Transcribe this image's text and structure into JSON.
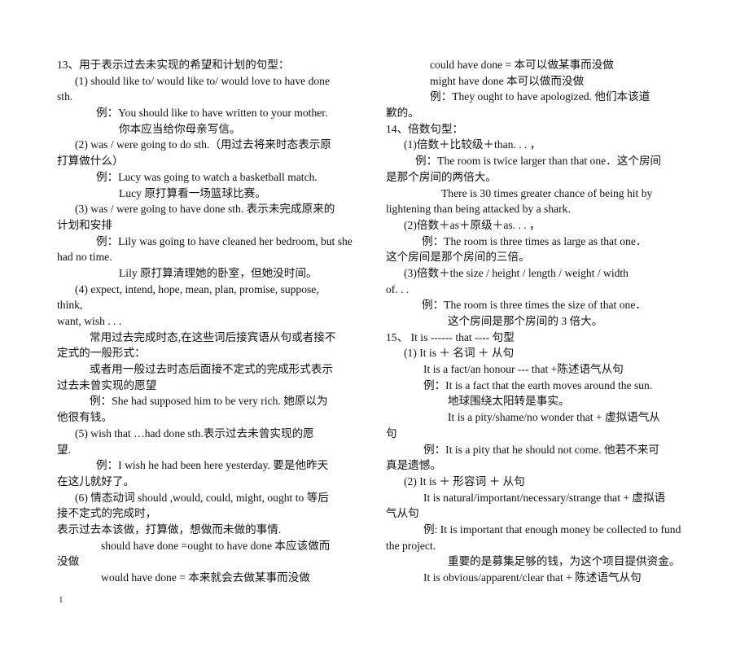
{
  "document": {
    "page_number": "1",
    "left_column": [
      {
        "text": "13、用于表示过去未实现的希望和计划的句型：",
        "indent": "",
        "role": "section-heading"
      },
      {
        "text": "(1) should like to/ would like to/ would love to have done",
        "indent": "i1",
        "role": "pattern"
      },
      {
        "text": "sth.",
        "indent": "",
        "role": "pattern-cont"
      },
      {
        "text": "例：You should like to have written to your mother.",
        "indent": "i2",
        "role": "example"
      },
      {
        "text": "你本应当给你母亲写信。",
        "indent": "i11",
        "role": "translation"
      },
      {
        "text": "(2) was / were going to do sth.（用过去将来时态表示原",
        "indent": "i1",
        "role": "pattern"
      },
      {
        "text": "打算做什么）",
        "indent": "",
        "role": "pattern-cont"
      },
      {
        "text": "例：Lucy was going to watch a basketball match.",
        "indent": "i2",
        "role": "example"
      },
      {
        "text": "Lucy  原打算看一场篮球比赛。",
        "indent": "i11",
        "role": "translation"
      },
      {
        "text": "(3) was / were going to have done sth.  表示未完成原来的",
        "indent": "i1",
        "role": "pattern"
      },
      {
        "text": "计划和安排",
        "indent": "",
        "role": "pattern-cont"
      },
      {
        "text": "例：Lily was going to have cleaned her bedroom, but she",
        "indent": "i2",
        "role": "example"
      },
      {
        "text": "had no time.",
        "indent": "",
        "role": "example-cont"
      },
      {
        "text": "Lily  原打算清理她的卧室，但她没时间。",
        "indent": "i11",
        "role": "translation"
      },
      {
        "text": "(4)  expect,  intend,  hope,  mean,  plan,  promise,  suppose,",
        "indent": "i1",
        "role": "pattern"
      },
      {
        "text": "think,",
        "indent": "",
        "role": "pattern-cont"
      },
      {
        "text": "want, wish  . . .",
        "indent": "",
        "role": "pattern-cont"
      },
      {
        "text": "常用过去完成时态,在这些词后接宾语从句或者接不",
        "indent": "i9",
        "role": "note"
      },
      {
        "text": "定式的一般形式：",
        "indent": "",
        "role": "note-cont"
      },
      {
        "text": "或者用一般过去时态后面接不定式的完成形式表示",
        "indent": "i9",
        "role": "note"
      },
      {
        "text": "过去未曾实现的愿望",
        "indent": "",
        "role": "note-cont"
      },
      {
        "text": "例：She had supposed him to be very rich.    她原以为",
        "indent": "i9",
        "role": "example"
      },
      {
        "text": "他很有钱。",
        "indent": "",
        "role": "example-cont"
      },
      {
        "text": "(5) wish that …had done sth.表示过去未曾实现的愿",
        "indent": "i1",
        "role": "pattern"
      },
      {
        "text": "望.",
        "indent": "",
        "role": "pattern-cont"
      },
      {
        "text": "例：I wish he had been here yesterday.  要是他昨天",
        "indent": "i2",
        "role": "example"
      },
      {
        "text": "在这儿就好了。",
        "indent": "",
        "role": "example-cont"
      },
      {
        "text": "(6)  情态动词 should ,would, could, might, ought to 等后",
        "indent": "i1",
        "role": "pattern"
      },
      {
        "text": "接不定式的完成时，",
        "indent": "",
        "role": "pattern-cont"
      },
      {
        "text": "表示过去本该做，打算做，想做而未做的事情.",
        "indent": "",
        "role": "note"
      },
      {
        "text": "should have done =ought to have done    本应该做而",
        "indent": "i5",
        "role": "pattern"
      },
      {
        "text": "没做",
        "indent": "",
        "role": "pattern-cont"
      },
      {
        "text": "would have done =  本来就会去做某事而没做",
        "indent": "i5",
        "role": "pattern"
      }
    ],
    "right_column": [
      {
        "text": "could have done =  本可以做某事而没做",
        "indent": "i5",
        "role": "pattern"
      },
      {
        "text": "might have done    本可以做而没做",
        "indent": "i5",
        "role": "pattern"
      },
      {
        "text": "例：They ought to have apologized.      他们本该道",
        "indent": "i5",
        "role": "example"
      },
      {
        "text": "歉的。",
        "indent": "",
        "role": "example-cont"
      },
      {
        "text": "14、倍数句型：",
        "indent": "",
        "role": "section-heading"
      },
      {
        "text": "(1)倍数＋比较级＋than. . . ，",
        "indent": "i1",
        "role": "pattern"
      },
      {
        "text": "例：The room is twice larger than that one．这个房间",
        "indent": "i3",
        "role": "example"
      },
      {
        "text": "是那个房间的两倍大。",
        "indent": "",
        "role": "example-cont"
      },
      {
        "text": "There  is  30  times  greater  chance  of  being  hit  by",
        "indent": "i7",
        "role": "example"
      },
      {
        "text": "lightening than being attacked by a shark.",
        "indent": "",
        "role": "example-cont"
      },
      {
        "text": "(2)倍数＋as＋原级＋as. . . ，",
        "indent": "i1",
        "role": "pattern"
      },
      {
        "text": "例：The room is three times as large as that one．",
        "indent": "i10",
        "role": "example"
      },
      {
        "text": "这个房间是那个房间的三倍。",
        "indent": "",
        "role": "translation"
      },
      {
        "text": "(3)倍数＋the size   / height / length    / weight    / width",
        "indent": "i1",
        "role": "pattern"
      },
      {
        "text": "of. . .",
        "indent": "",
        "role": "pattern-cont"
      },
      {
        "text": "例：The room is three times the size of that one．",
        "indent": "i10",
        "role": "example"
      },
      {
        "text": "这个房间是那个房间的 3 倍大。",
        "indent": "i6",
        "role": "translation"
      },
      {
        "text": "15、   It is ------ that ----  句型",
        "indent": "",
        "role": "section-heading"
      },
      {
        "text": "(1) It is  ＋  名词  ＋  从句",
        "indent": "i1",
        "role": "pattern"
      },
      {
        "text": "It is a fact/an honour ---     that    +陈述语气从句",
        "indent": "i4",
        "role": "pattern"
      },
      {
        "text": "例：It is a fact that the earth moves around the sun.",
        "indent": "i4",
        "role": "example"
      },
      {
        "text": "地球围绕太阳转是事实。",
        "indent": "i6",
        "role": "translation"
      },
      {
        "text": "It is a pity/shame/no wonder that    +  虚拟语气从",
        "indent": "i6",
        "role": "pattern"
      },
      {
        "text": "句",
        "indent": "",
        "role": "pattern-cont"
      },
      {
        "text": "例：It is a pity that he should not come.  他若不来可",
        "indent": "i4",
        "role": "example"
      },
      {
        "text": "真是遗憾。",
        "indent": "",
        "role": "example-cont"
      },
      {
        "text": "(2) It is  ＋  形容词  ＋  从句",
        "indent": "i1",
        "role": "pattern"
      },
      {
        "text": "It is natural/important/necessary/strange that +  虚拟语",
        "indent": "i4",
        "role": "pattern"
      },
      {
        "text": "气从句",
        "indent": "",
        "role": "pattern-cont"
      },
      {
        "text": "例: It is important that enough money be collected to fund",
        "indent": "i4",
        "role": "example"
      },
      {
        "text": "the project.",
        "indent": "",
        "role": "example-cont"
      },
      {
        "text": "重要的是募集足够的钱，为这个项目提供资金。",
        "indent": "i6",
        "role": "translation"
      },
      {
        "text": "It is obvious/apparent/clear that    +  陈述语气从句",
        "indent": "i4",
        "role": "pattern"
      }
    ]
  }
}
